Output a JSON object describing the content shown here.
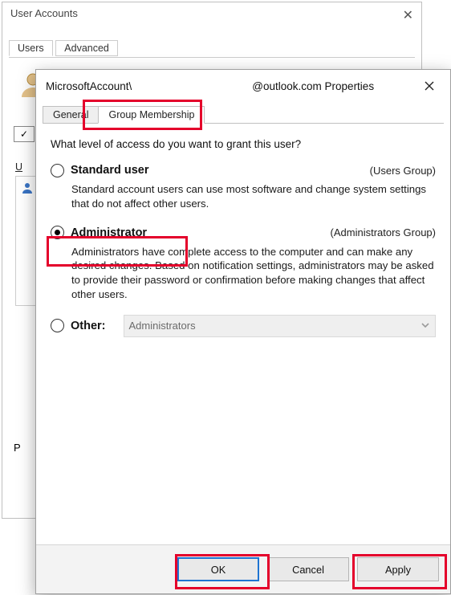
{
  "parent_dialog": {
    "title": "User Accounts",
    "tabs": [
      "Users",
      "Advanced"
    ],
    "group_label_prefix": "U",
    "pwd_label_prefix": "P"
  },
  "properties_dialog": {
    "title_prefix": "MicrosoftAccount\\",
    "title_middle": "",
    "title_suffix": "@outlook.com Properties",
    "tabs": {
      "general": "General",
      "group_membership": "Group Membership"
    },
    "question": "What level of access do you want to grant this user?",
    "options": {
      "standard": {
        "title": "Standard user",
        "group": "(Users Group)",
        "desc": "Standard account users can use most software and change system settings that do not affect other users."
      },
      "admin": {
        "title": "Administrator",
        "group": "(Administrators Group)",
        "desc": "Administrators have complete access to the computer and can make any desired changes. Based on notification settings, administrators may be asked to provide their password or confirmation before making changes that affect other users."
      },
      "other": {
        "title": "Other:",
        "combo_value": "Administrators"
      }
    },
    "selected": "admin",
    "buttons": {
      "ok": "OK",
      "cancel": "Cancel",
      "apply": "Apply"
    }
  }
}
